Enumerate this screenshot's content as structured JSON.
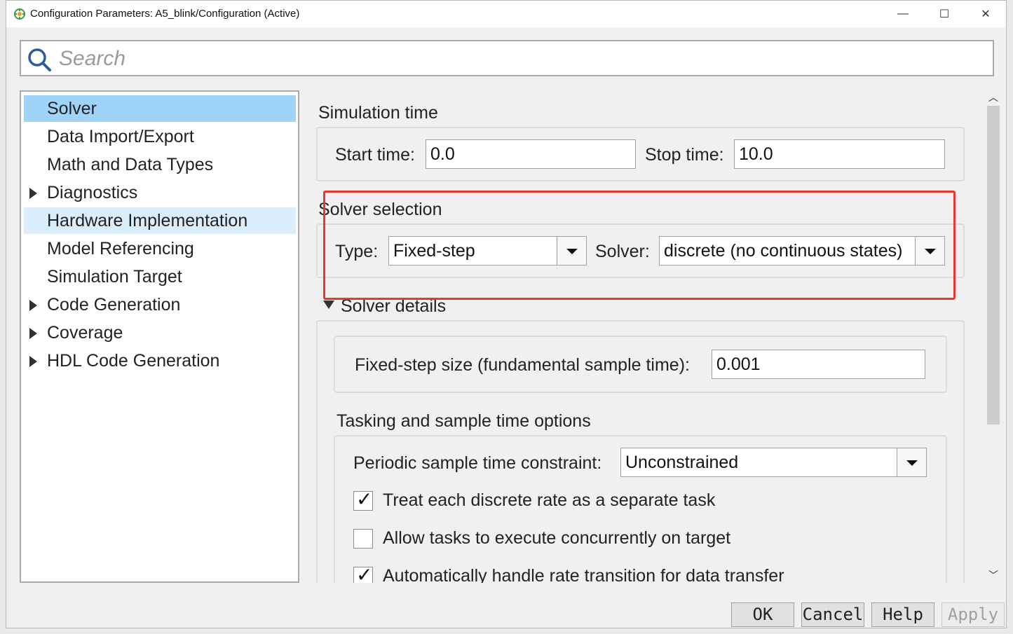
{
  "window": {
    "title": "Configuration Parameters: A5_blink/Configuration (Active)",
    "minimize_symbol": "—",
    "maximize_symbol": "☐",
    "close_symbol": "✕"
  },
  "search": {
    "placeholder": "Search"
  },
  "nav": {
    "items": [
      {
        "label": "Solver",
        "expandable": false,
        "state": "selected"
      },
      {
        "label": "Data Import/Export",
        "expandable": false,
        "state": "normal"
      },
      {
        "label": "Math and Data Types",
        "expandable": false,
        "state": "normal"
      },
      {
        "label": "Diagnostics",
        "expandable": true,
        "state": "normal"
      },
      {
        "label": "Hardware Implementation",
        "expandable": false,
        "state": "hovered"
      },
      {
        "label": "Model Referencing",
        "expandable": false,
        "state": "normal"
      },
      {
        "label": "Simulation Target",
        "expandable": false,
        "state": "normal"
      },
      {
        "label": "Code Generation",
        "expandable": true,
        "state": "normal"
      },
      {
        "label": "Coverage",
        "expandable": true,
        "state": "normal"
      },
      {
        "label": "HDL Code Generation",
        "expandable": true,
        "state": "normal"
      }
    ]
  },
  "simulation_time": {
    "title": "Simulation time",
    "start_label": "Start time:",
    "start_value": "0.0",
    "stop_label": "Stop time:",
    "stop_value": "10.0"
  },
  "solver_selection": {
    "title": "Solver selection",
    "type_label": "Type:",
    "type_value": "Fixed-step",
    "solver_label": "Solver:",
    "solver_value": "discrete (no continuous states)"
  },
  "solver_details": {
    "title": "Solver details",
    "fixed_step_label": "Fixed-step size (fundamental sample time):",
    "fixed_step_value": "0.001"
  },
  "tasking": {
    "title": "Tasking and sample time options",
    "constraint_label": "Periodic sample time constraint:",
    "constraint_value": "Unconstrained",
    "checkboxes": [
      {
        "label": "Treat each discrete rate as a separate task",
        "checked": true
      },
      {
        "label": "Allow tasks to execute concurrently on target",
        "checked": false
      },
      {
        "label": "Automatically handle rate transition for data transfer",
        "checked": true
      }
    ]
  },
  "footer": {
    "ok": "OK",
    "cancel": "Cancel",
    "help": "Help",
    "apply": "Apply",
    "apply_enabled": false
  },
  "colors": {
    "selected_nav": "#9fd3f7",
    "hovered_nav": "#d9edfa",
    "annotation_red": "#e53935"
  }
}
